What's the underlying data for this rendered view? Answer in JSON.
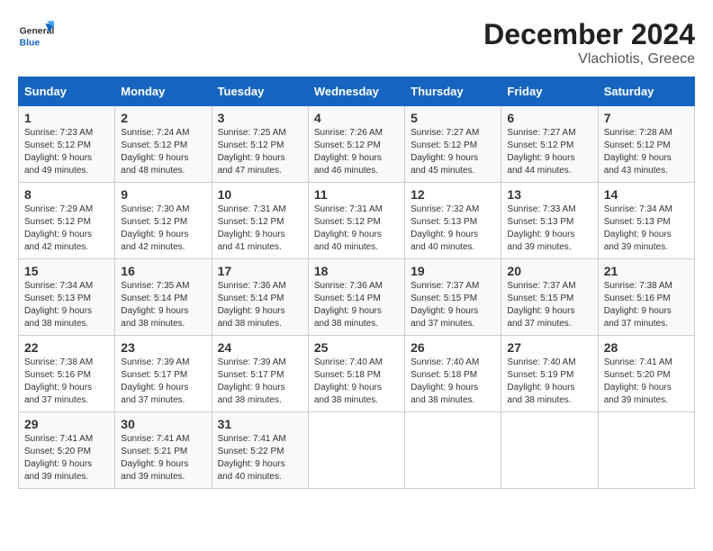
{
  "header": {
    "logo_general": "General",
    "logo_blue": "Blue",
    "month": "December 2024",
    "location": "Vlachiotis, Greece"
  },
  "days_of_week": [
    "Sunday",
    "Monday",
    "Tuesday",
    "Wednesday",
    "Thursday",
    "Friday",
    "Saturday"
  ],
  "weeks": [
    [
      {
        "day": "1",
        "sunrise": "7:23 AM",
        "sunset": "5:12 PM",
        "daylight": "9 hours and 49 minutes."
      },
      {
        "day": "2",
        "sunrise": "7:24 AM",
        "sunset": "5:12 PM",
        "daylight": "9 hours and 48 minutes."
      },
      {
        "day": "3",
        "sunrise": "7:25 AM",
        "sunset": "5:12 PM",
        "daylight": "9 hours and 47 minutes."
      },
      {
        "day": "4",
        "sunrise": "7:26 AM",
        "sunset": "5:12 PM",
        "daylight": "9 hours and 46 minutes."
      },
      {
        "day": "5",
        "sunrise": "7:27 AM",
        "sunset": "5:12 PM",
        "daylight": "9 hours and 45 minutes."
      },
      {
        "day": "6",
        "sunrise": "7:27 AM",
        "sunset": "5:12 PM",
        "daylight": "9 hours and 44 minutes."
      },
      {
        "day": "7",
        "sunrise": "7:28 AM",
        "sunset": "5:12 PM",
        "daylight": "9 hours and 43 minutes."
      }
    ],
    [
      {
        "day": "8",
        "sunrise": "7:29 AM",
        "sunset": "5:12 PM",
        "daylight": "9 hours and 42 minutes."
      },
      {
        "day": "9",
        "sunrise": "7:30 AM",
        "sunset": "5:12 PM",
        "daylight": "9 hours and 42 minutes."
      },
      {
        "day": "10",
        "sunrise": "7:31 AM",
        "sunset": "5:12 PM",
        "daylight": "9 hours and 41 minutes."
      },
      {
        "day": "11",
        "sunrise": "7:31 AM",
        "sunset": "5:12 PM",
        "daylight": "9 hours and 40 minutes."
      },
      {
        "day": "12",
        "sunrise": "7:32 AM",
        "sunset": "5:13 PM",
        "daylight": "9 hours and 40 minutes."
      },
      {
        "day": "13",
        "sunrise": "7:33 AM",
        "sunset": "5:13 PM",
        "daylight": "9 hours and 39 minutes."
      },
      {
        "day": "14",
        "sunrise": "7:34 AM",
        "sunset": "5:13 PM",
        "daylight": "9 hours and 39 minutes."
      }
    ],
    [
      {
        "day": "15",
        "sunrise": "7:34 AM",
        "sunset": "5:13 PM",
        "daylight": "9 hours and 38 minutes."
      },
      {
        "day": "16",
        "sunrise": "7:35 AM",
        "sunset": "5:14 PM",
        "daylight": "9 hours and 38 minutes."
      },
      {
        "day": "17",
        "sunrise": "7:36 AM",
        "sunset": "5:14 PM",
        "daylight": "9 hours and 38 minutes."
      },
      {
        "day": "18",
        "sunrise": "7:36 AM",
        "sunset": "5:14 PM",
        "daylight": "9 hours and 38 minutes."
      },
      {
        "day": "19",
        "sunrise": "7:37 AM",
        "sunset": "5:15 PM",
        "daylight": "9 hours and 37 minutes."
      },
      {
        "day": "20",
        "sunrise": "7:37 AM",
        "sunset": "5:15 PM",
        "daylight": "9 hours and 37 minutes."
      },
      {
        "day": "21",
        "sunrise": "7:38 AM",
        "sunset": "5:16 PM",
        "daylight": "9 hours and 37 minutes."
      }
    ],
    [
      {
        "day": "22",
        "sunrise": "7:38 AM",
        "sunset": "5:16 PM",
        "daylight": "9 hours and 37 minutes."
      },
      {
        "day": "23",
        "sunrise": "7:39 AM",
        "sunset": "5:17 PM",
        "daylight": "9 hours and 37 minutes."
      },
      {
        "day": "24",
        "sunrise": "7:39 AM",
        "sunset": "5:17 PM",
        "daylight": "9 hours and 38 minutes."
      },
      {
        "day": "25",
        "sunrise": "7:40 AM",
        "sunset": "5:18 PM",
        "daylight": "9 hours and 38 minutes."
      },
      {
        "day": "26",
        "sunrise": "7:40 AM",
        "sunset": "5:18 PM",
        "daylight": "9 hours and 38 minutes."
      },
      {
        "day": "27",
        "sunrise": "7:40 AM",
        "sunset": "5:19 PM",
        "daylight": "9 hours and 38 minutes."
      },
      {
        "day": "28",
        "sunrise": "7:41 AM",
        "sunset": "5:20 PM",
        "daylight": "9 hours and 39 minutes."
      }
    ],
    [
      {
        "day": "29",
        "sunrise": "7:41 AM",
        "sunset": "5:20 PM",
        "daylight": "9 hours and 39 minutes."
      },
      {
        "day": "30",
        "sunrise": "7:41 AM",
        "sunset": "5:21 PM",
        "daylight": "9 hours and 39 minutes."
      },
      {
        "day": "31",
        "sunrise": "7:41 AM",
        "sunset": "5:22 PM",
        "daylight": "9 hours and 40 minutes."
      },
      null,
      null,
      null,
      null
    ]
  ],
  "labels": {
    "sunrise": "Sunrise:",
    "sunset": "Sunset:",
    "daylight": "Daylight:"
  }
}
